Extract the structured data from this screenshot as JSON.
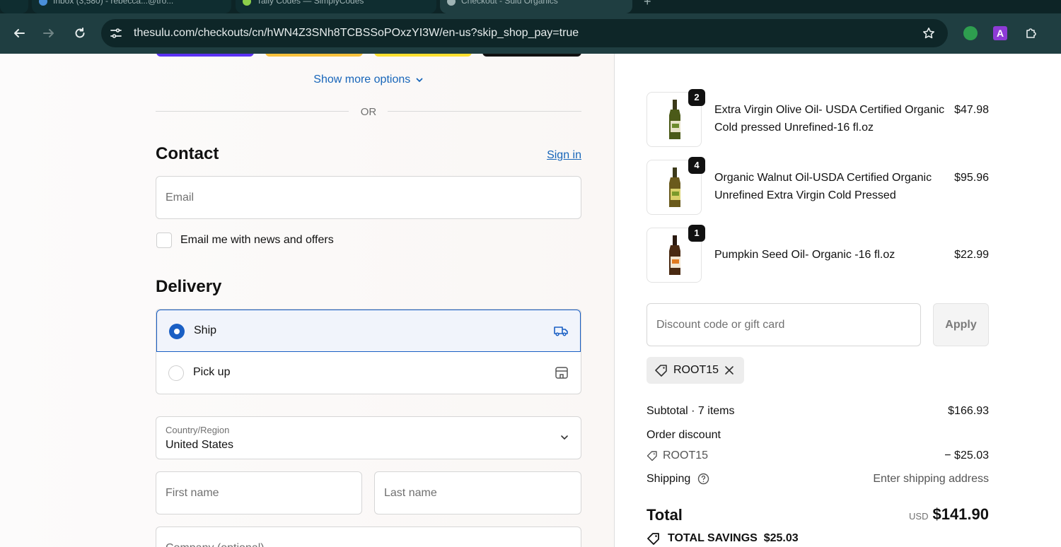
{
  "browser": {
    "tabs": [
      {
        "title": "Inbox (3,580) - rebecca...@tro..."
      },
      {
        "title": "Tally Codes — SimplyCodes"
      },
      {
        "title": "Checkout - Sulu Organics"
      }
    ],
    "url_domain": "thesulu.com",
    "url_path": "/checkouts/cn/hWN4Z3SNh8TCBSSoPOxzYI3W/en-us?skip_shop_pay=true",
    "profile_initial": "A"
  },
  "checkout": {
    "show_more_label": "Show more options",
    "or_label": "OR",
    "contact": {
      "heading": "Contact",
      "sign_in_label": "Sign in",
      "email_placeholder": "Email",
      "news_label": "Email me with news and offers"
    },
    "delivery": {
      "heading": "Delivery",
      "options": [
        {
          "label": "Ship",
          "selected": true,
          "icon": "truck-icon"
        },
        {
          "label": "Pick up",
          "selected": false,
          "icon": "store-icon"
        }
      ],
      "country_label": "Country/Region",
      "country_value": "United States",
      "first_name_placeholder": "First name",
      "last_name_placeholder": "Last name",
      "company_placeholder": "Company (optional)"
    }
  },
  "summary": {
    "items": [
      {
        "name": "Extra Virgin Olive Oil- USDA Certified Organic Cold pressed Unrefined-16 fl.oz",
        "qty": "2",
        "price": "$47.98"
      },
      {
        "name": "Organic Walnut Oil-USDA Certified Organic Unrefined Extra Virgin Cold Pressed",
        "qty": "4",
        "price": "$95.96"
      },
      {
        "name": "Pumpkin Seed Oil- Organic -16 fl.oz",
        "qty": "1",
        "price": "$22.99"
      }
    ],
    "discount_placeholder": "Discount code or gift card",
    "apply_label": "Apply",
    "applied_code": "ROOT15",
    "subtotal_label": "Subtotal · 7 items",
    "subtotal_value": "$166.93",
    "order_discount_label": "Order discount",
    "discount_code": "ROOT15",
    "discount_value": "− $25.03",
    "shipping_label": "Shipping",
    "shipping_value": "Enter shipping address",
    "total_label": "Total",
    "currency": "USD",
    "total_value": "$141.90",
    "savings_label": "TOTAL SAVINGS",
    "savings_value": "$25.03"
  },
  "colors": {
    "accent": "#1a5fc4",
    "link": "#1765b9",
    "chrome": "#1f3e41"
  }
}
